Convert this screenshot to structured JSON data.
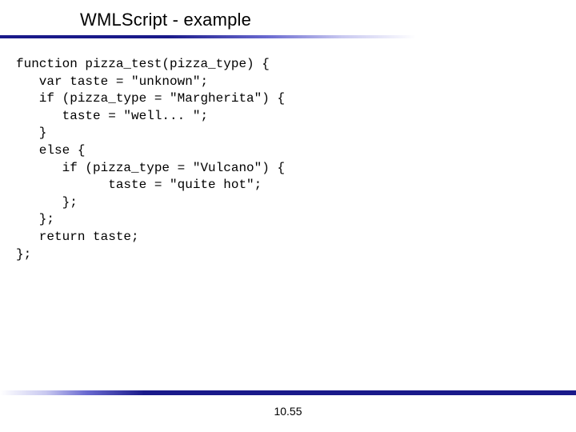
{
  "slide": {
    "title": "WMLScript - example",
    "page_number": "10.55"
  },
  "code": {
    "lines": [
      "function pizza_test(pizza_type) {",
      "   var taste = \"unknown\";",
      "   if (pizza_type = \"Margherita\") {",
      "      taste = \"well... \";",
      "   }",
      "   else {",
      "      if (pizza_type = \"Vulcano\") {",
      "            taste = \"quite hot\";",
      "      };",
      "   };",
      "   return taste;",
      "};"
    ]
  }
}
